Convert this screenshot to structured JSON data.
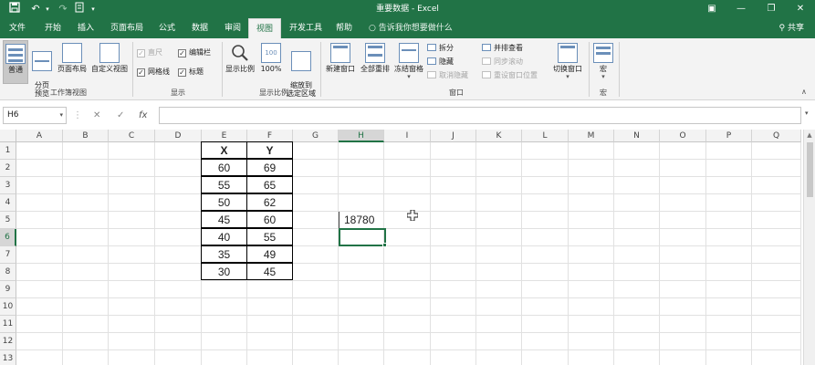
{
  "titlebar": {
    "title": "重要数据 - Excel",
    "save_icon": "save-icon",
    "undo_glyph": "↶",
    "redo_glyph": "↷",
    "minimize_glyph": "—",
    "restore_glyph": "❐",
    "close_glyph": "✕",
    "ribbon_opts_glyph": "▣"
  },
  "menu": {
    "tabs": [
      "文件",
      "开始",
      "插入",
      "页面布局",
      "公式",
      "数据",
      "审阅",
      "视图",
      "开发工具",
      "帮助"
    ],
    "active_tab": "视图",
    "tell_me": "告诉我你想要做什么",
    "share": "共享"
  },
  "ribbon": {
    "normal": "普通",
    "page_break": "分页\n预览",
    "page_layout": "页面布局",
    "custom_views": "自定义视图",
    "group_views": "工作簿视图",
    "ruler": "直尺",
    "formula_bar": "编辑栏",
    "gridlines": "网格线",
    "headings": "标题",
    "group_show": "显示",
    "zoom": "显示比例",
    "zoom_100": "100%",
    "zoom_selection": "缩放到\n选定区域",
    "group_zoom": "显示比例",
    "new_window": "新建窗口",
    "arrange_all": "全部重排",
    "freeze_panes": "冻结窗格",
    "split": "拆分",
    "hide": "隐藏",
    "unhide": "取消隐藏",
    "side_by_side": "并排查看",
    "sync_scroll": "同步滚动",
    "reset_position": "重设窗口位置",
    "switch_windows": "切换窗口",
    "group_window": "窗口",
    "macros": "宏",
    "group_macros": "宏"
  },
  "formula_bar": {
    "name_box": "H6",
    "cancel_glyph": "✕",
    "enter_glyph": "✓",
    "fx": "fx",
    "content": ""
  },
  "grid": {
    "columns": [
      "A",
      "B",
      "C",
      "D",
      "E",
      "F",
      "G",
      "H",
      "I",
      "J",
      "K",
      "L",
      "M",
      "N",
      "O",
      "P",
      "Q"
    ],
    "rows": [
      "1",
      "2",
      "3",
      "4",
      "5",
      "6",
      "7",
      "8",
      "9",
      "10",
      "11",
      "12",
      "13"
    ],
    "selected_cell": "H6",
    "table": {
      "headers": [
        "X",
        "Y"
      ],
      "x": [
        "60",
        "55",
        "50",
        "45",
        "40",
        "35",
        "30"
      ],
      "y": [
        "69",
        "65",
        "62",
        "60",
        "55",
        "49",
        "45"
      ]
    },
    "h5_value": "18780"
  },
  "colors": {
    "accent": "#217346",
    "ribbon_bg": "#f3f3f3"
  }
}
